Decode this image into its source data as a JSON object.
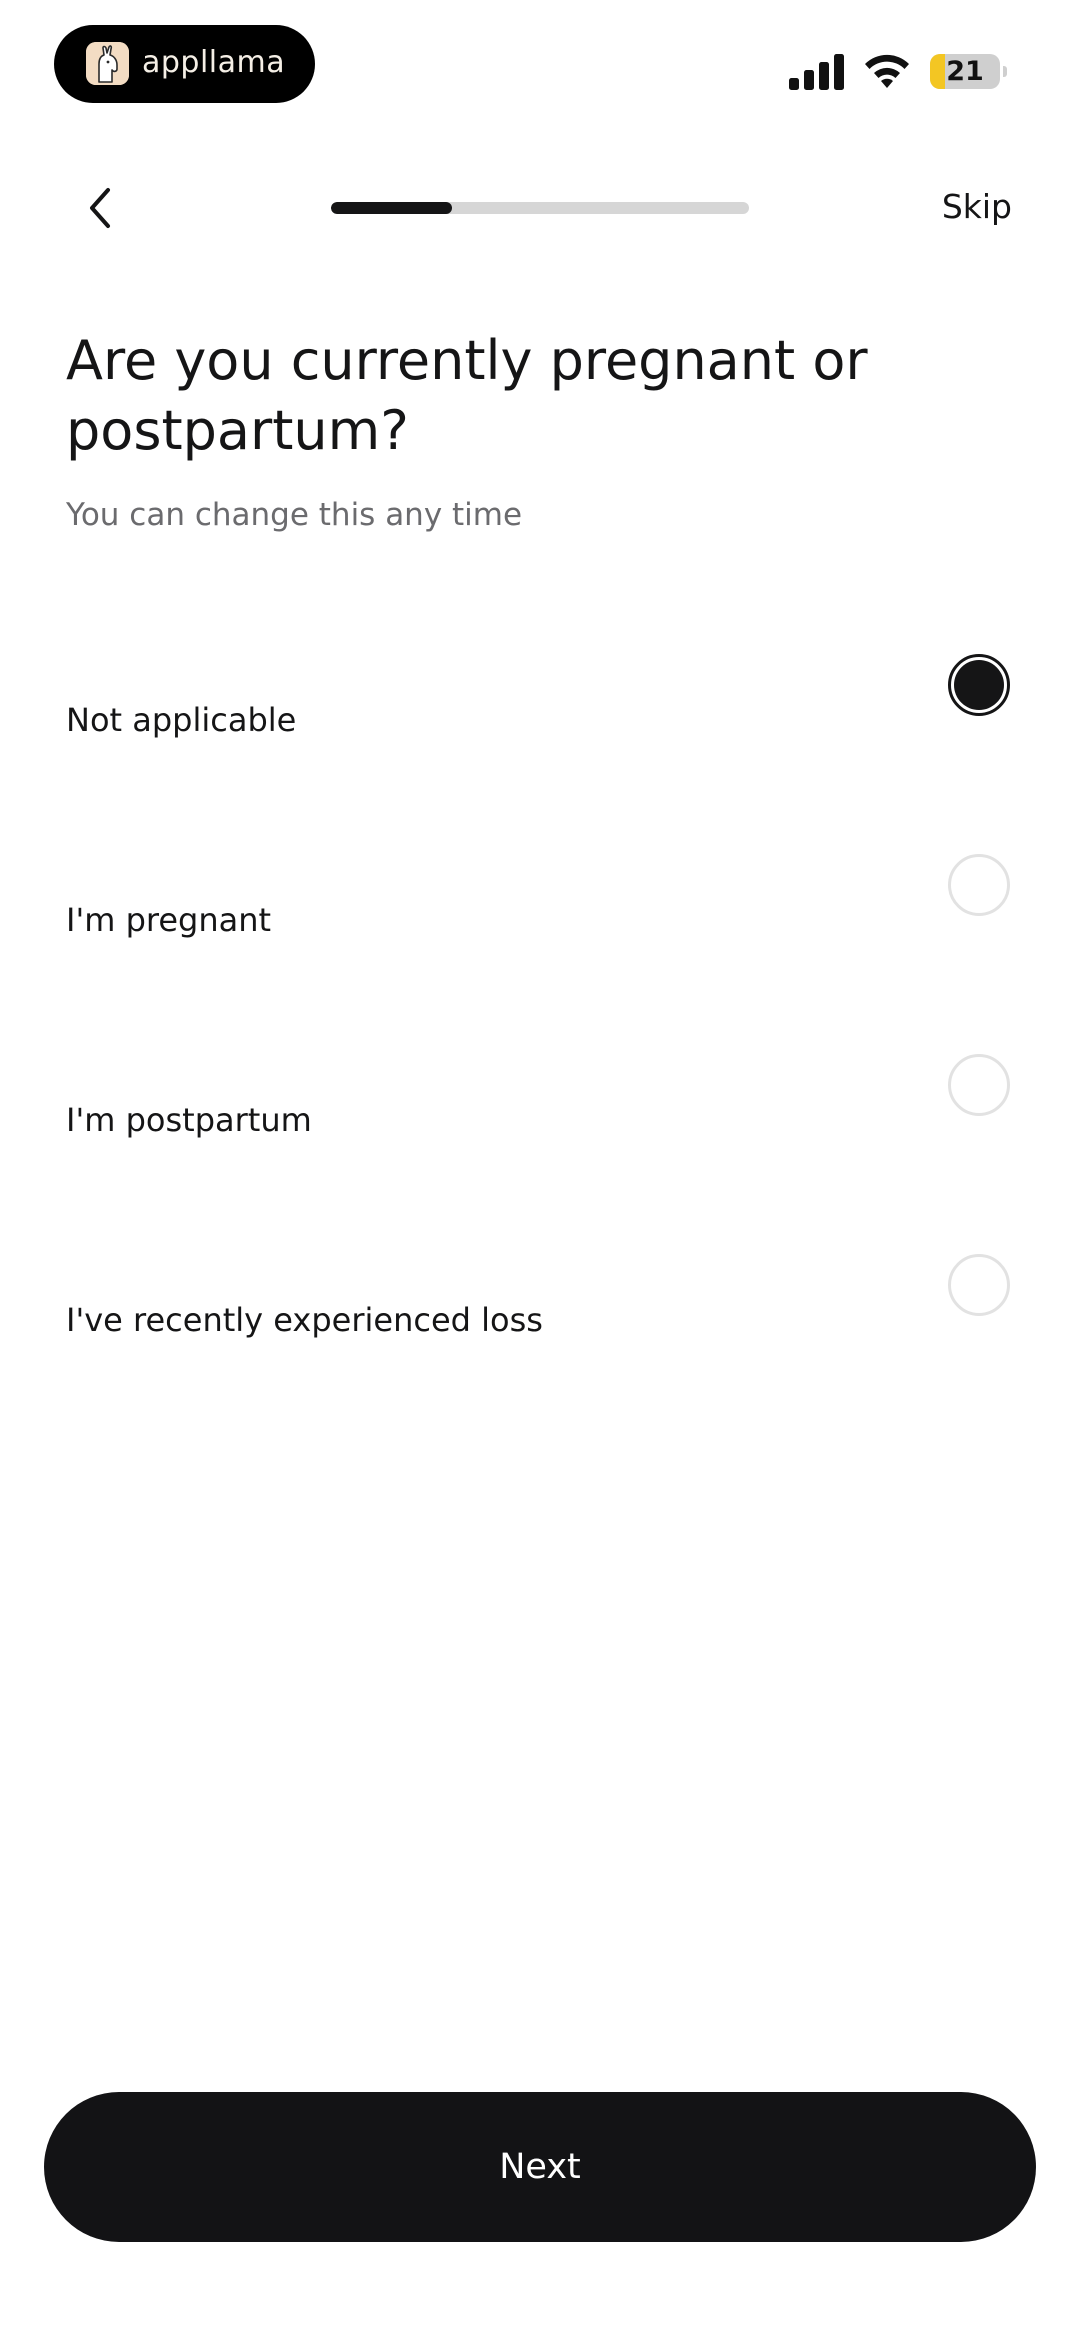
{
  "status_bar": {
    "brand_name": "appllama",
    "battery_level": "21",
    "battery_fraction": 0.21,
    "icons": [
      "llama-logo-icon",
      "cellular-signal-icon",
      "wifi-icon",
      "battery-icon"
    ]
  },
  "nav": {
    "back_icon": "chevron-left-icon",
    "progress_fraction": 0.29,
    "skip_label": "Skip"
  },
  "question": {
    "title": "Are you currently pregnant or postpartum?",
    "subtitle": "You can change this any time"
  },
  "options": [
    {
      "label": "Not applicable",
      "selected": true
    },
    {
      "label": "I'm pregnant",
      "selected": false
    },
    {
      "label": "I'm postpartum",
      "selected": false
    },
    {
      "label": "I've recently experienced loss",
      "selected": false
    }
  ],
  "footer": {
    "next_label": "Next"
  },
  "colors": {
    "primary": "#151516",
    "progress_track": "#d6d6d6",
    "battery_fill": "#f3c623",
    "radio_border": "#e2e2e2",
    "subtitle": "#6b6b6e"
  }
}
